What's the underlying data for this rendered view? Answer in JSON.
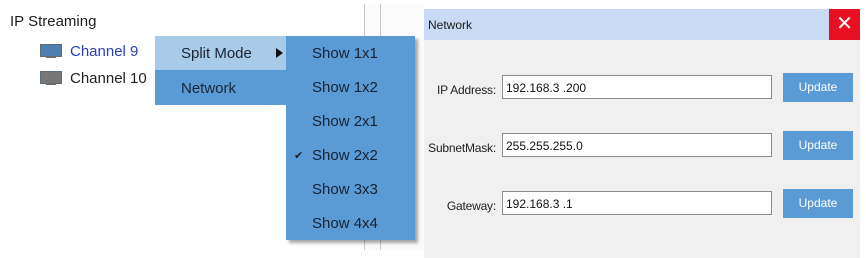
{
  "tree": {
    "title": "IP Streaming",
    "items": [
      {
        "label": "Channel 9",
        "icon": "monitor-icon"
      },
      {
        "label": "Channel 10",
        "icon": "monitor-icon"
      }
    ]
  },
  "context_menu": {
    "items": [
      {
        "label": "Split Mode",
        "has_submenu": true,
        "highlighted": true
      },
      {
        "label": "Network"
      }
    ]
  },
  "submenu": {
    "items": [
      {
        "label": "Show 1x1"
      },
      {
        "label": "Show 1x2"
      },
      {
        "label": "Show 2x1"
      },
      {
        "label": "Show 2x2",
        "checked": true
      },
      {
        "label": "Show 3x3"
      },
      {
        "label": "Show 4x4"
      }
    ],
    "check_glyph": "✔"
  },
  "dialog": {
    "title": "Network",
    "close_glyph": "✕",
    "fields": [
      {
        "label": "IP Address:",
        "value": "192.168.3  .200",
        "button": "Update"
      },
      {
        "label": "SubnetMask:",
        "value": "255.255.255.0",
        "button": "Update"
      },
      {
        "label": "Gateway:",
        "value": "192.168.3  .1",
        "button": "Update"
      }
    ]
  },
  "colors": {
    "menu_blue": "#5b9bd5",
    "menu_highlight": "#a9cbea",
    "dialog_header": "#c9daf4",
    "close_red": "#e81123",
    "channel_selected_text": "#2b3fb8"
  }
}
